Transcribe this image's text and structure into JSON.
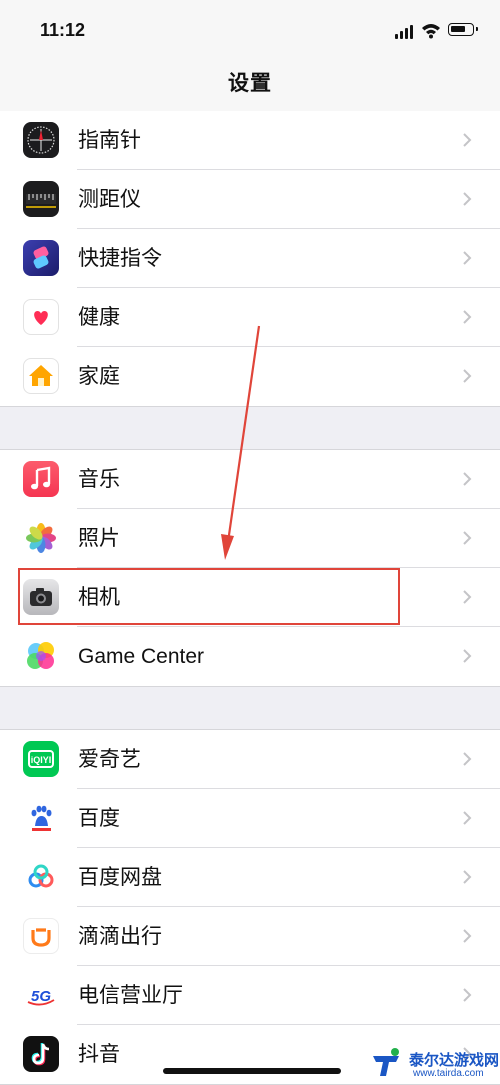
{
  "status_bar": {
    "time": "11:12",
    "icons": [
      "cellular-signal-icon",
      "wifi-icon",
      "battery-icon"
    ]
  },
  "nav": {
    "title": "设置"
  },
  "groups": [
    {
      "items": [
        {
          "label": "指南针",
          "icon": "compass-icon"
        },
        {
          "label": "测距仪",
          "icon": "measure-icon"
        },
        {
          "label": "快捷指令",
          "icon": "shortcuts-icon"
        },
        {
          "label": "健康",
          "icon": "health-heart-icon"
        },
        {
          "label": "家庭",
          "icon": "home-house-icon"
        }
      ]
    },
    {
      "items": [
        {
          "label": "音乐",
          "icon": "music-note-icon"
        },
        {
          "label": "照片",
          "icon": "photos-flower-icon"
        },
        {
          "label": "相机",
          "icon": "camera-icon",
          "highlighted": true
        },
        {
          "label": "Game Center",
          "icon": "game-center-icon"
        }
      ]
    },
    {
      "items": [
        {
          "label": "爱奇艺",
          "icon": "iqiyi-icon"
        },
        {
          "label": "百度",
          "icon": "baidu-paw-icon"
        },
        {
          "label": "百度网盘",
          "icon": "baidu-netdisk-icon"
        },
        {
          "label": "滴滴出行",
          "icon": "didi-icon"
        },
        {
          "label": "电信营业厅",
          "icon": "telecom-5g-icon"
        },
        {
          "label": "抖音",
          "icon": "douyin-icon"
        }
      ]
    }
  ],
  "annotation": {
    "color": "#e0453a"
  },
  "watermark": {
    "title": "泰尔达游戏网",
    "url": "www.tairda.com"
  },
  "colors": {
    "background": "#efeff4",
    "row_bg": "#ffffff",
    "chevron": "#c4c4c7"
  }
}
